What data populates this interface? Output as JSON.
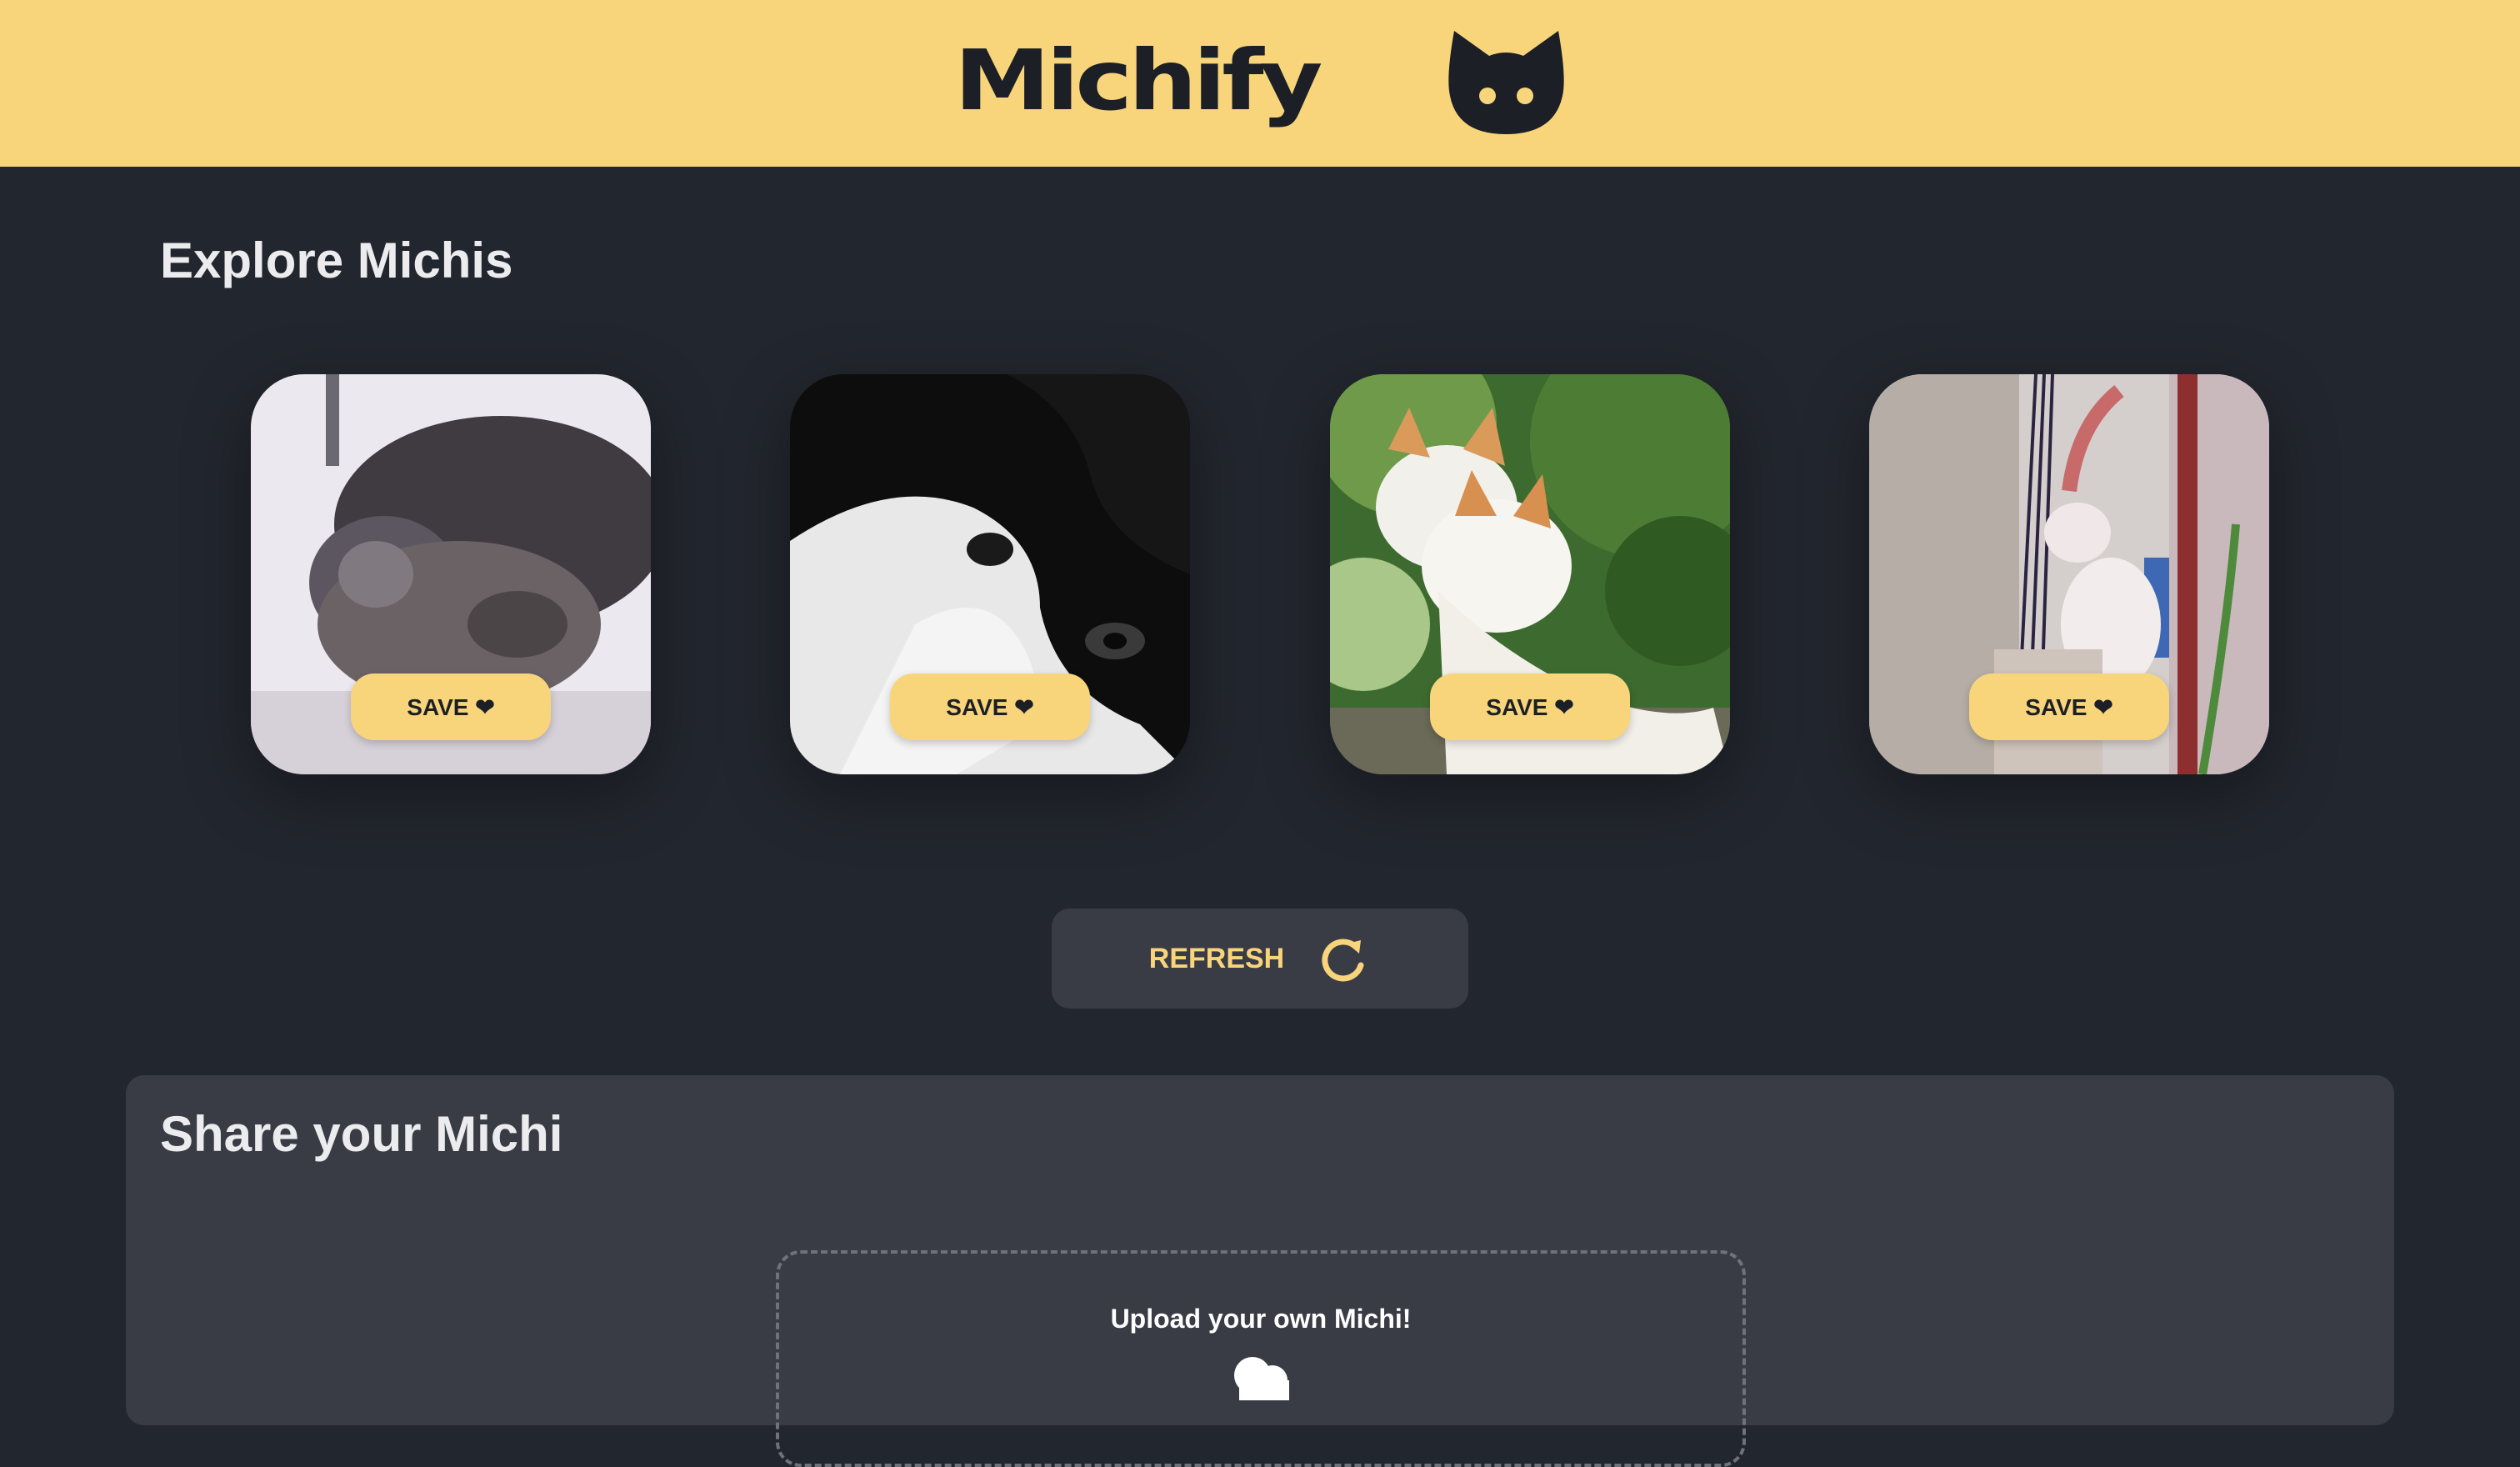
{
  "header": {
    "brand": "Michify",
    "logo_icon": "cat-head-icon",
    "background": "#f8d57b"
  },
  "explore": {
    "title": "Explore Michis",
    "cards": [
      {
        "photo": "cat-photo-kittens-playing",
        "save_label": "SAVE ❤"
      },
      {
        "photo": "cat-photo-black-white-closeup",
        "save_label": "SAVE ❤"
      },
      {
        "photo": "cat-photo-two-cats-nuzzling",
        "save_label": "SAVE ❤"
      },
      {
        "photo": "cat-photo-white-cat-by-net",
        "save_label": "SAVE ❤"
      }
    ],
    "refresh_label": "REFRESH",
    "refresh_icon": "refresh-icon"
  },
  "share": {
    "title": "Share your Michi",
    "upload_text": "Upload your own Michi!",
    "upload_icon": "cloud-upload-icon"
  },
  "colors": {
    "accent": "#f8d57b",
    "background": "#22262e",
    "panel": "#393c45",
    "text_light": "#ececee"
  }
}
